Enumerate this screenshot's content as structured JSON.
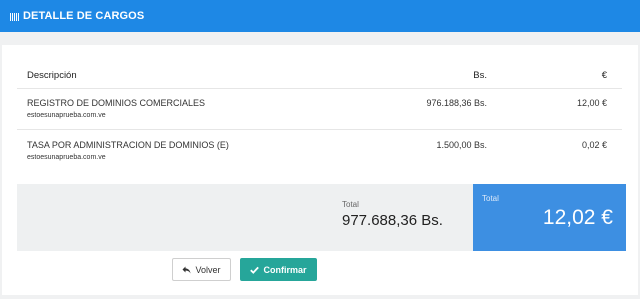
{
  "header": {
    "title": "DETALLE DE CARGOS",
    "icon": "barcode-icon"
  },
  "table": {
    "columns": {
      "description": "Descripción",
      "bs": "Bs.",
      "eur": "€"
    },
    "rows": [
      {
        "description": "REGISTRO DE DOMINIOS COMERCIALES",
        "domain": "estoesunaprueba.com.ve",
        "bs": "976.188,36 Bs.",
        "eur": "12,00 €"
      },
      {
        "description": "TASA POR ADMINISTRACION DE DOMINIOS (E)",
        "domain": "estoesunaprueba.com.ve",
        "bs": "1.500,00 Bs.",
        "eur": "0,02 €"
      }
    ]
  },
  "totals": {
    "bs_label": "Total",
    "bs_value": "977.688,36 Bs.",
    "eur_label": "Total",
    "eur_value": "12,02 €",
    "eur_bg": "#3d8fe2"
  },
  "actions": {
    "back_label": "Volver",
    "back_icon": "reply-arrow-icon",
    "confirm_label": "Confirmar",
    "confirm_icon": "check-icon",
    "confirm_color": "#26a69a"
  },
  "colors": {
    "header": "#1e88e5"
  }
}
